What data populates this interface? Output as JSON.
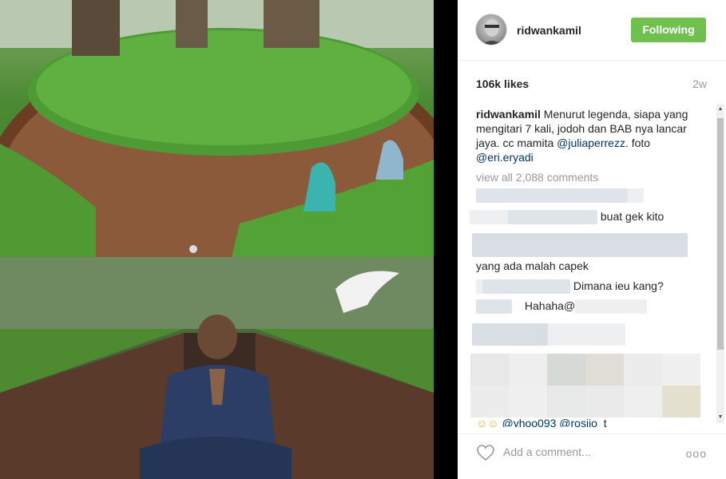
{
  "post": {
    "username": "ridwankamil",
    "follow_label": "Following",
    "likes": "106k likes",
    "time_ago": "2w",
    "caption_user": "ridwankamil",
    "caption_text": " Menurut legenda, siapa yang mengitari 7 kali, jodoh dan BAB nya lancar jaya. cc mamita ",
    "caption_mention1": "@juliaperrezz",
    "caption_text2": ". foto ",
    "caption_mention2": "@eri.eryadi",
    "view_all": "view all 2,088 comments"
  },
  "comments": [
    {
      "text": ""
    },
    {
      "text": "buat gek kito"
    },
    {
      "text": ""
    },
    {
      "text": "yang ada malah capek"
    },
    {
      "text": "Dimana ieu kang?"
    },
    {
      "text": "Hahaha@"
    },
    {
      "text": ""
    },
    {
      "text": "@yhoo093 @rosiio_t"
    }
  ],
  "footer": {
    "add_comment_placeholder": "Add a comment...",
    "more_label": "ooo"
  },
  "icons": {
    "heart": "heart-outline-icon",
    "more": "more-dots-icon"
  },
  "colors": {
    "follow_button": "#70c050",
    "link": "#003569",
    "muted": "#999999"
  }
}
